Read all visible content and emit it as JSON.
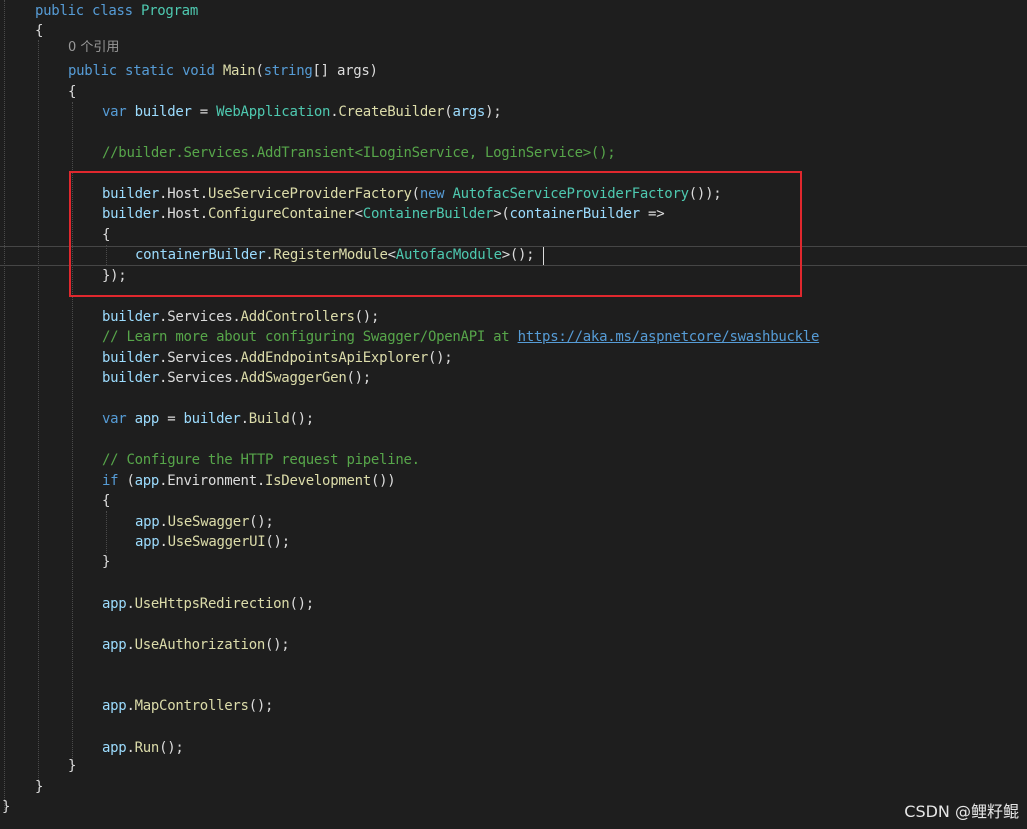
{
  "editor": {
    "codelens": "0 个引用",
    "lines": [
      [
        {
          "t": "public class ",
          "c": "kw"
        },
        {
          "t": "Program",
          "c": "type"
        }
      ],
      [
        {
          "t": "{",
          "c": "plain"
        }
      ],
      [
        {
          "t": "public static void ",
          "c": "kw"
        },
        {
          "t": "Main",
          "c": "method"
        },
        {
          "t": "(",
          "c": "plain"
        },
        {
          "t": "string",
          "c": "kw"
        },
        {
          "t": "[] args)",
          "c": "plain"
        }
      ],
      [
        {
          "t": "{",
          "c": "plain"
        }
      ],
      [
        {
          "t": "var ",
          "c": "kw"
        },
        {
          "t": "builder",
          "c": "param"
        },
        {
          "t": " = ",
          "c": "plain"
        },
        {
          "t": "WebApplication",
          "c": "type"
        },
        {
          "t": ".",
          "c": "plain"
        },
        {
          "t": "CreateBuilder",
          "c": "method"
        },
        {
          "t": "(",
          "c": "plain"
        },
        {
          "t": "args",
          "c": "param"
        },
        {
          "t": ");",
          "c": "plain"
        }
      ],
      [
        {
          "t": "//builder.Services.AddTransient<ILoginService, LoginService>();",
          "c": "comment"
        }
      ],
      [
        {
          "t": "builder",
          "c": "param"
        },
        {
          "t": ".Host.",
          "c": "plain"
        },
        {
          "t": "UseServiceProviderFactory",
          "c": "method"
        },
        {
          "t": "(",
          "c": "plain"
        },
        {
          "t": "new ",
          "c": "kw"
        },
        {
          "t": "AutofacServiceProviderFactory",
          "c": "type"
        },
        {
          "t": "());",
          "c": "plain"
        }
      ],
      [
        {
          "t": "builder",
          "c": "param"
        },
        {
          "t": ".Host.",
          "c": "plain"
        },
        {
          "t": "ConfigureContainer",
          "c": "method"
        },
        {
          "t": "<",
          "c": "plain"
        },
        {
          "t": "ContainerBuilder",
          "c": "type"
        },
        {
          "t": ">(",
          "c": "plain"
        },
        {
          "t": "containerBuilder",
          "c": "param"
        },
        {
          "t": " =>",
          "c": "plain"
        }
      ],
      [
        {
          "t": "{",
          "c": "plain"
        }
      ],
      [
        {
          "t": "containerBuilder",
          "c": "param"
        },
        {
          "t": ".",
          "c": "plain"
        },
        {
          "t": "RegisterModule",
          "c": "method"
        },
        {
          "t": "<",
          "c": "plain"
        },
        {
          "t": "AutofacModule",
          "c": "type"
        },
        {
          "t": ">();",
          "c": "plain"
        }
      ],
      [
        {
          "t": "});",
          "c": "plain"
        }
      ],
      [
        {
          "t": "builder",
          "c": "param"
        },
        {
          "t": ".Services.",
          "c": "plain"
        },
        {
          "t": "AddControllers",
          "c": "method"
        },
        {
          "t": "();",
          "c": "plain"
        }
      ],
      [
        {
          "t": "// Learn more about configuring Swagger/OpenAPI at ",
          "c": "comment"
        },
        {
          "t": "https://aka.ms/aspnetcore/swashbuckle",
          "c": "link"
        }
      ],
      [
        {
          "t": "builder",
          "c": "param"
        },
        {
          "t": ".Services.",
          "c": "plain"
        },
        {
          "t": "AddEndpointsApiExplorer",
          "c": "method"
        },
        {
          "t": "();",
          "c": "plain"
        }
      ],
      [
        {
          "t": "builder",
          "c": "param"
        },
        {
          "t": ".Services.",
          "c": "plain"
        },
        {
          "t": "AddSwaggerGen",
          "c": "method"
        },
        {
          "t": "();",
          "c": "plain"
        }
      ],
      [
        {
          "t": "var ",
          "c": "kw"
        },
        {
          "t": "app",
          "c": "param"
        },
        {
          "t": " = ",
          "c": "plain"
        },
        {
          "t": "builder",
          "c": "param"
        },
        {
          "t": ".",
          "c": "plain"
        },
        {
          "t": "Build",
          "c": "method"
        },
        {
          "t": "();",
          "c": "plain"
        }
      ],
      [
        {
          "t": "// Configure the HTTP request pipeline.",
          "c": "comment"
        }
      ],
      [
        {
          "t": "if ",
          "c": "kw"
        },
        {
          "t": "(",
          "c": "plain"
        },
        {
          "t": "app",
          "c": "param"
        },
        {
          "t": ".Environment.",
          "c": "plain"
        },
        {
          "t": "IsDevelopment",
          "c": "method"
        },
        {
          "t": "())",
          "c": "plain"
        }
      ],
      [
        {
          "t": "{",
          "c": "plain"
        }
      ],
      [
        {
          "t": "app",
          "c": "param"
        },
        {
          "t": ".",
          "c": "plain"
        },
        {
          "t": "UseSwagger",
          "c": "method"
        },
        {
          "t": "();",
          "c": "plain"
        }
      ],
      [
        {
          "t": "app",
          "c": "param"
        },
        {
          "t": ".",
          "c": "plain"
        },
        {
          "t": "UseSwaggerUI",
          "c": "method"
        },
        {
          "t": "();",
          "c": "plain"
        }
      ],
      [
        {
          "t": "}",
          "c": "plain"
        }
      ],
      [
        {
          "t": "app",
          "c": "param"
        },
        {
          "t": ".",
          "c": "plain"
        },
        {
          "t": "UseHttpsRedirection",
          "c": "method"
        },
        {
          "t": "();",
          "c": "plain"
        }
      ],
      [
        {
          "t": "app",
          "c": "param"
        },
        {
          "t": ".",
          "c": "plain"
        },
        {
          "t": "UseAuthorization",
          "c": "method"
        },
        {
          "t": "();",
          "c": "plain"
        }
      ],
      [
        {
          "t": "app",
          "c": "param"
        },
        {
          "t": ".",
          "c": "plain"
        },
        {
          "t": "MapControllers",
          "c": "method"
        },
        {
          "t": "();",
          "c": "plain"
        }
      ],
      [
        {
          "t": "app",
          "c": "param"
        },
        {
          "t": ".",
          "c": "plain"
        },
        {
          "t": "Run",
          "c": "method"
        },
        {
          "t": "();",
          "c": "plain"
        }
      ],
      [
        {
          "t": "}",
          "c": "plain"
        }
      ],
      [
        {
          "t": "}",
          "c": "plain"
        }
      ],
      [
        {
          "t": "}",
          "c": "plain"
        }
      ]
    ]
  },
  "watermark": "CSDN @鲤籽鲲",
  "colors": {
    "background": "#1e1e1e",
    "keyword": "#569cd6",
    "type": "#4ec9b0",
    "method": "#dcdcaa",
    "identifier": "#9cdcfe",
    "comment": "#57a64a",
    "plain": "#dcdcdc",
    "highlight_box": "#e0282e"
  }
}
